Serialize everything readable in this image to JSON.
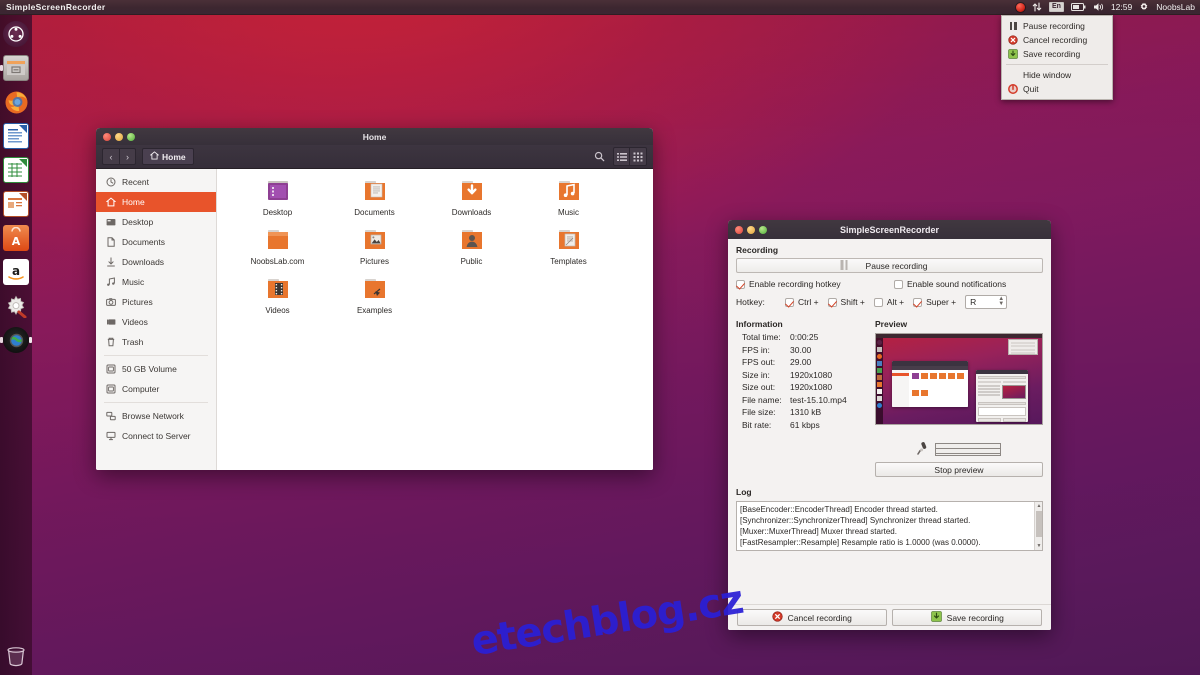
{
  "panel": {
    "app_name": "SimpleScreenRecorder",
    "indicators": [
      {
        "name": "recording-indicator-icon",
        "label": "recording-dot"
      },
      {
        "name": "network-icon",
        "label": "network-up-down"
      },
      {
        "name": "keyboard-layout-indicator",
        "label": "En"
      },
      {
        "name": "battery-icon",
        "label": "battery"
      },
      {
        "name": "volume-icon",
        "label": "volume"
      }
    ],
    "keyboard_layout": "En",
    "clock": "12:59",
    "session_icon": "gear-icon",
    "username": "NoobsLab"
  },
  "ssr_menu": {
    "items": [
      {
        "icon": "pause-icon",
        "label": "Pause recording"
      },
      {
        "icon": "cancel-icon",
        "label": "Cancel recording"
      },
      {
        "icon": "save-icon",
        "label": "Save recording"
      }
    ],
    "items2": [
      {
        "icon": "none",
        "label": "Hide window"
      },
      {
        "icon": "quit-icon",
        "label": "Quit"
      }
    ]
  },
  "launcher": {
    "items": [
      {
        "name": "dash-home",
        "label": "Ubuntu Dash"
      },
      {
        "name": "files",
        "label": "Files"
      },
      {
        "name": "firefox",
        "label": "Firefox"
      },
      {
        "name": "libreoffice-writer",
        "label": "LibreOffice Writer"
      },
      {
        "name": "libreoffice-calc",
        "label": "LibreOffice Calc"
      },
      {
        "name": "libreoffice-impress",
        "label": "LibreOffice Impress"
      },
      {
        "name": "ubuntu-software",
        "label": "Ubuntu Software"
      },
      {
        "name": "amazon",
        "label": "Amazon"
      },
      {
        "name": "system-settings",
        "label": "System Settings"
      },
      {
        "name": "system-monitor",
        "label": "System Monitor"
      }
    ],
    "trash_label": "Trash"
  },
  "nautilus": {
    "title": "Home",
    "breadcrumb": "Home",
    "back_label": "‹",
    "forward_label": "›",
    "search_icon": "search-icon",
    "view_list_icon": "list-view-icon",
    "view_grid_icon": "grid-view-icon",
    "sidebar": [
      {
        "label": "Recent",
        "icon": "clock-icon",
        "active": false
      },
      {
        "label": "Home",
        "icon": "home-icon",
        "active": true
      },
      {
        "label": "Desktop",
        "icon": "desktop-icon",
        "active": false
      },
      {
        "label": "Documents",
        "icon": "document-icon",
        "active": false
      },
      {
        "label": "Downloads",
        "icon": "download-icon",
        "active": false
      },
      {
        "label": "Music",
        "icon": "music-icon",
        "active": false
      },
      {
        "label": "Pictures",
        "icon": "camera-icon",
        "active": false
      },
      {
        "label": "Videos",
        "icon": "video-icon",
        "active": false
      },
      {
        "label": "Trash",
        "icon": "trash-icon",
        "active": false
      }
    ],
    "sidebar_devices": [
      {
        "label": "50 GB Volume",
        "icon": "drive-icon"
      },
      {
        "label": "Computer",
        "icon": "computer-icon"
      }
    ],
    "sidebar_network": [
      {
        "label": "Browse Network",
        "icon": "network-icon"
      },
      {
        "label": "Connect to Server",
        "icon": "server-icon"
      }
    ],
    "files": [
      {
        "label": "Desktop",
        "kind": "desktop"
      },
      {
        "label": "Documents",
        "kind": "documents"
      },
      {
        "label": "Downloads",
        "kind": "downloads"
      },
      {
        "label": "Music",
        "kind": "music"
      },
      {
        "label": "NoobsLab.com",
        "kind": "plain"
      },
      {
        "label": "Pictures",
        "kind": "pictures"
      },
      {
        "label": "Public",
        "kind": "public"
      },
      {
        "label": "Templates",
        "kind": "templates"
      },
      {
        "label": "Videos",
        "kind": "videos"
      },
      {
        "label": "Examples",
        "kind": "examples"
      }
    ]
  },
  "ssr": {
    "title": "SimpleScreenRecorder",
    "recording_group": "Recording",
    "pause_button": "Pause recording",
    "enable_hotkey": {
      "label": "Enable recording hotkey",
      "checked": true
    },
    "enable_sound": {
      "label": "Enable sound notifications",
      "checked": false
    },
    "hotkey_label": "Hotkey:",
    "hotkey_modifiers": [
      {
        "label": "Ctrl +",
        "checked": true
      },
      {
        "label": "Shift +",
        "checked": true
      },
      {
        "label": "Alt +",
        "checked": false
      },
      {
        "label": "Super +",
        "checked": true
      }
    ],
    "hotkey_key": "R",
    "information_group": "Information",
    "information": [
      {
        "key": "Total time:",
        "value": "0:00:25"
      },
      {
        "key": "FPS in:",
        "value": "30.00"
      },
      {
        "key": "FPS out:",
        "value": "29.00"
      },
      {
        "key": "Size in:",
        "value": "1920x1080"
      },
      {
        "key": "Size out:",
        "value": "1920x1080"
      },
      {
        "key": "File name:",
        "value": "test-15.10.mp4"
      },
      {
        "key": "File size:",
        "value": "1310 kB"
      },
      {
        "key": "Bit rate:",
        "value": "61 kbps"
      }
    ],
    "preview_group": "Preview",
    "mic_icon": "microphone-icon",
    "stop_preview": "Stop preview",
    "log_group": "Log",
    "log_lines": [
      "[BaseEncoder::EncoderThread] Encoder thread started.",
      "[Synchronizer::SynchronizerThread] Synchronizer thread started.",
      "[Muxer::MuxerThread] Muxer thread started.",
      "[FastResampler::Resample] Resample ratio is 1.0000 (was 0.0000)."
    ],
    "cancel_button": "Cancel recording",
    "save_button": "Save recording"
  },
  "watermark": "etechblog.cz",
  "colors": {
    "ubuntu_orange": "#e8542b",
    "window_titlebar": "#3b3340",
    "panel": "#3d2730",
    "accent_red": "#d4462a",
    "watermark_blue": "#2a1fd6"
  }
}
